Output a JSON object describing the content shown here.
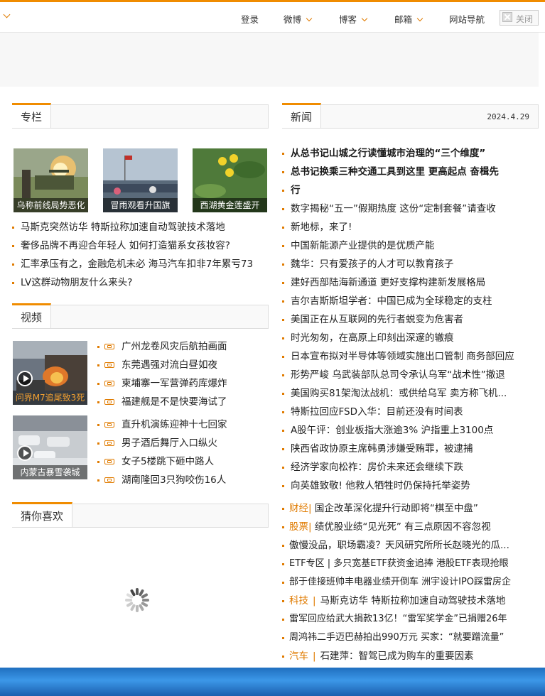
{
  "topnav": {
    "login": "登录",
    "weibo": "微博",
    "blog": "博客",
    "mail": "邮箱",
    "sitenav": "网站导航",
    "close": "关闭"
  },
  "zhuanlan": {
    "title": "专栏",
    "thumbs": [
      "乌称前线局势恶化",
      "冒雨观看升国旗",
      "西湖黄金莲盛开"
    ],
    "items": [
      "马斯克突然访华 特斯拉称加速自动驾驶技术落地",
      "奢侈品牌不再迎合年轻人 如何打造猫系女孩妆容?",
      "汇率承压有之，金融危机未必 海马汽车扣非7年累亏73",
      "LV这群动物朋友什么来头?"
    ]
  },
  "video": {
    "title": "视频",
    "thumbs": [
      "问界M7追尾致3死",
      "内蒙古暴雪袭城"
    ],
    "items": [
      "广州龙卷风灾后航拍画面",
      "东莞遇强对流白昼如夜",
      "柬埔寨一军营弹药库爆炸",
      "福建舰是不是快要海试了",
      "直升机演练迎神十七回家",
      "男子酒后舞厅入口纵火",
      "女子5楼跳下砸中路人",
      "湖南隆回3只狗咬伤16人"
    ]
  },
  "guess": {
    "title": "猜你喜欢"
  },
  "news": {
    "title": "新闻",
    "date": "2024.4.29",
    "headline1": "从总书记山城之行读懂城市治理的“三个维度”",
    "headline2a": "总书记换乘三种交通工具到这里 更高起点 奋楫先",
    "headline2b": "行",
    "items": [
      "数字揭秘“五一”假期热度 这份“定制套餐”请查收",
      "新地标，来了!",
      "中国新能源产业提供的是优质产能",
      "魏华：只有爱孩子的人才可以教育孩子",
      "建好西部陆海新通道 更好支撑构建新发展格局",
      "吉尔吉斯斯坦学者：中国已成为全球稳定的支柱",
      "美国正在从互联网的先行者蜕变为危害者",
      "时光匆匆，在高原上印刻出深邃的辙痕",
      "日本宣布拟对半导体等领域实施出口管制 商务部回应",
      "形势严峻 乌武装部队总司令承认乌军“战术性”撤退",
      "美国购买81架淘汰战机：或供给乌军 卖方称飞机...",
      "特斯拉回应FSD入华：目前还没有时间表",
      "A股午评：创业板指大涨逾3% 沪指重上3100点",
      "陕西省政协原主席韩勇涉嫌受贿罪，被逮捕",
      "经济学家向松祚：房价未来还会继续下跌",
      "向英雄致敬! 他救人牺牲时仍保持托举姿势"
    ],
    "bottom": [
      {
        "tag": "财经",
        "text": "国企改革深化提升行动即将“棋至中盘”"
      },
      {
        "tag": "股票",
        "text": "绩优股业绩“见光死” 有三点原因不容忽视"
      },
      {
        "tag": "",
        "text": "傲慢没品，职场霸凌？天风研究所所长赵晓光的瓜..."
      },
      {
        "tag": "",
        "text": "ETF专区 | 多只宽基ETF获资金追捧 港股ETF表现抢眼"
      },
      {
        "tag": "",
        "text": "部于佳接班帅丰电器业绩开倒车 洲宇设计IPO踩雷房企"
      },
      {
        "tag": "科技",
        "text": "马斯克访华 特斯拉称加速自动驾驶技术落地"
      },
      {
        "tag": "",
        "text": "雷军回应给武大捐款13亿！“雷军奖学金”已捐赠26年"
      },
      {
        "tag": "",
        "text": "周鸿祎二手迈巴赫拍出990万元 买家：“就要蹭流量”"
      },
      {
        "tag": "汽车",
        "text": "石建萍：智驾已成为购车的重要因素"
      }
    ]
  },
  "colors": {
    "accent": "#f08c00",
    "tag": "#e07b00"
  }
}
